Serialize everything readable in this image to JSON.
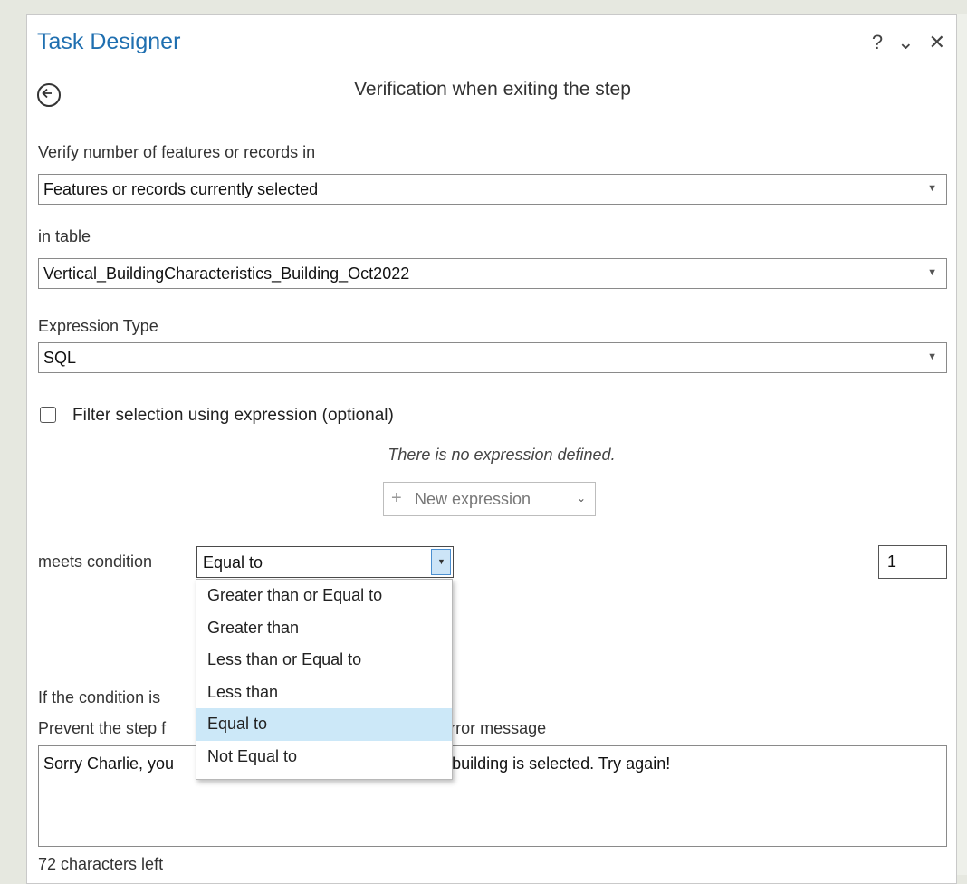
{
  "window": {
    "title": "Task Designer",
    "help_label": "?",
    "menu_label": "⌄",
    "close_label": "✕"
  },
  "header": {
    "subtitle": "Verification when exiting the step"
  },
  "verify": {
    "label": "Verify number of features or records in",
    "value": "Features or records currently selected"
  },
  "table": {
    "label": "in table",
    "value": "Vertical_BuildingCharacteristics_Building_Oct2022"
  },
  "expression_type": {
    "label": "Expression Type",
    "value": "SQL"
  },
  "filter": {
    "label": "Filter selection using expression (optional)",
    "checked": false,
    "no_expression_text": "There is no expression defined.",
    "new_expression_label": "New expression"
  },
  "condition": {
    "label": "meets condition",
    "selected": "Equal to",
    "count": "1",
    "options": [
      "Greater than or Equal to",
      "Greater than",
      "Less than or Equal to",
      "Less than",
      "Equal to",
      "Not Equal to"
    ],
    "highlighted_option": "Equal to"
  },
  "failure": {
    "if_label_visible": "If the condition is",
    "prevent_label_left": "Prevent the step f",
    "prevent_label_right": "his error message",
    "message_left": "Sorry Charlie, you",
    "message_right": "E building is selected. Try again!",
    "chars_left": "72 characters left"
  },
  "colors": {
    "title": "#1f6fb0",
    "selection_highlight": "#cce8f8",
    "dropdown_button": "#cce4f7"
  },
  "icons": {
    "back": "back-arrow-icon",
    "dropdown": "chevron-down-icon",
    "add": "plus-icon"
  }
}
